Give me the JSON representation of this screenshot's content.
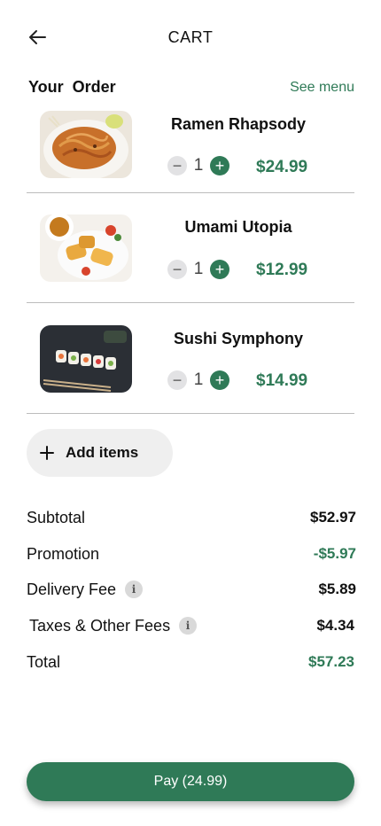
{
  "header": {
    "title": "CART",
    "back_icon": "arrow-left-icon"
  },
  "order": {
    "title": "Your  Order",
    "see_menu": "See menu"
  },
  "items": [
    {
      "name": "Ramen Rhapsody",
      "qty": "1",
      "price": "$24.99"
    },
    {
      "name": "Umami Utopia",
      "qty": "1",
      "price": "$12.99"
    },
    {
      "name": "Sushi Symphony",
      "qty": "1",
      "price": "$14.99"
    }
  ],
  "add_items": {
    "label": "Add items"
  },
  "summary": {
    "subtotal": {
      "label": "Subtotal",
      "value": "$52.97"
    },
    "promotion": {
      "label": "Promotion",
      "value": "-$5.97"
    },
    "delivery": {
      "label": "Delivery Fee",
      "value": "$5.89"
    },
    "taxes": {
      "label": "Taxes & Other Fees",
      "value": "$4.34"
    },
    "total": {
      "label": "Total",
      "value": "$57.23"
    }
  },
  "pay": {
    "label": "Pay (24.99)"
  },
  "colors": {
    "accent": "#2f7a57",
    "minus_bg": "#e2e2e4",
    "pill_bg": "#efefef",
    "divider": "#bcbcbc"
  }
}
